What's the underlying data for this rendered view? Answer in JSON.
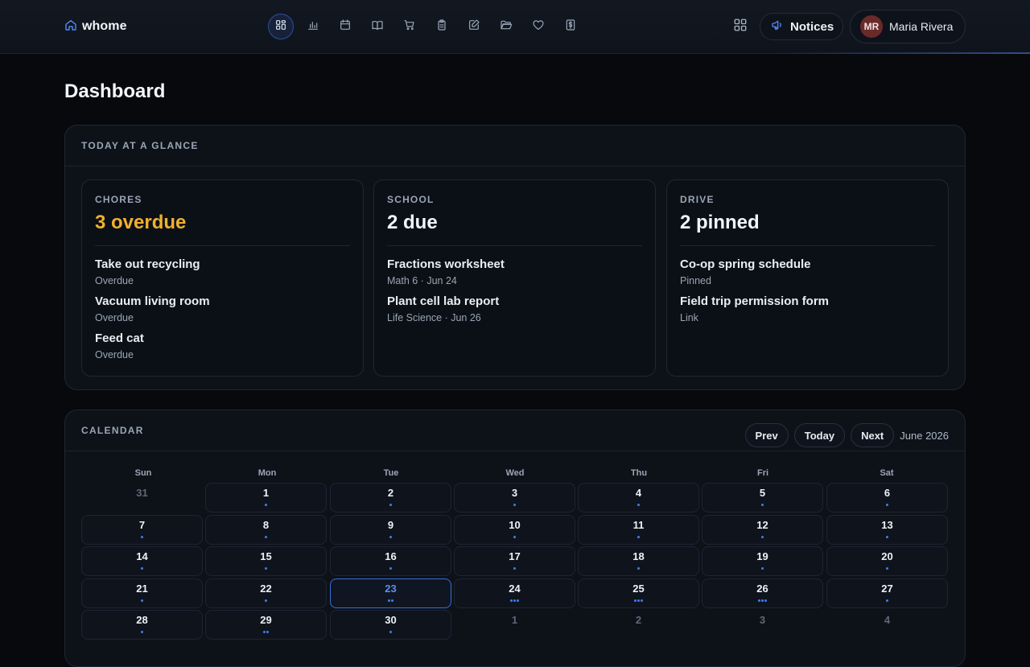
{
  "brand": {
    "name": "whome"
  },
  "header": {
    "nav": [
      {
        "icon": "dashboard-icon",
        "active": true
      },
      {
        "icon": "bar-chart-icon",
        "active": false
      },
      {
        "icon": "calendar-icon",
        "active": false
      },
      {
        "icon": "book-open-icon",
        "active": false
      },
      {
        "icon": "shopping-cart-icon",
        "active": false
      },
      {
        "icon": "clipboard-icon",
        "active": false
      },
      {
        "icon": "edit-note-icon",
        "active": false
      },
      {
        "icon": "folder-open-icon",
        "active": false
      },
      {
        "icon": "heart-icon",
        "active": false
      },
      {
        "icon": "dollar-receipt-icon",
        "active": false
      }
    ],
    "notices_label": "Notices",
    "user": {
      "initials": "MR",
      "name": "Maria Rivera"
    }
  },
  "page": {
    "title": "Dashboard"
  },
  "glance": {
    "title": "TODAY AT A GLANCE",
    "cards": [
      {
        "label": "CHORES",
        "value": "3 overdue",
        "warn": true,
        "items": [
          {
            "title": "Take out recycling",
            "sub": "Overdue"
          },
          {
            "title": "Vacuum living room",
            "sub": "Overdue"
          },
          {
            "title": "Feed cat",
            "sub": "Overdue"
          }
        ]
      },
      {
        "label": "SCHOOL",
        "value": "2 due",
        "warn": false,
        "items": [
          {
            "title": "Fractions worksheet",
            "sub": "Math 6 · Jun 24"
          },
          {
            "title": "Plant cell lab report",
            "sub": "Life Science · Jun 26"
          }
        ]
      },
      {
        "label": "DRIVE",
        "value": "2 pinned",
        "warn": false,
        "items": [
          {
            "title": "Co-op spring schedule",
            "sub": "Pinned"
          },
          {
            "title": "Field trip permission form",
            "sub": "Link"
          }
        ]
      }
    ]
  },
  "calendar": {
    "title": "CALENDAR",
    "prev_label": "Prev",
    "today_label": "Today",
    "next_label": "Next",
    "month_label": "June 2026",
    "weekdays": [
      "Sun",
      "Mon",
      "Tue",
      "Wed",
      "Thu",
      "Fri",
      "Sat"
    ],
    "weeks": [
      [
        {
          "d": "31",
          "muted": true,
          "dots": 0
        },
        {
          "d": "1",
          "dots": 1
        },
        {
          "d": "2",
          "dots": 1
        },
        {
          "d": "3",
          "dots": 1
        },
        {
          "d": "4",
          "dots": 1
        },
        {
          "d": "5",
          "dots": 1
        },
        {
          "d": "6",
          "dots": 1
        }
      ],
      [
        {
          "d": "7",
          "dots": 1
        },
        {
          "d": "8",
          "dots": 1
        },
        {
          "d": "9",
          "dots": 1
        },
        {
          "d": "10",
          "dots": 1
        },
        {
          "d": "11",
          "dots": 1
        },
        {
          "d": "12",
          "dots": 1
        },
        {
          "d": "13",
          "dots": 1
        }
      ],
      [
        {
          "d": "14",
          "dots": 1
        },
        {
          "d": "15",
          "dots": 1
        },
        {
          "d": "16",
          "dots": 1
        },
        {
          "d": "17",
          "dots": 1
        },
        {
          "d": "18",
          "dots": 1
        },
        {
          "d": "19",
          "dots": 1
        },
        {
          "d": "20",
          "dots": 1
        }
      ],
      [
        {
          "d": "21",
          "dots": 1
        },
        {
          "d": "22",
          "dots": 1
        },
        {
          "d": "23",
          "today": true,
          "dots": 2
        },
        {
          "d": "24",
          "dots": 3
        },
        {
          "d": "25",
          "dots": 3
        },
        {
          "d": "26",
          "dots": 3
        },
        {
          "d": "27",
          "dots": 1
        }
      ],
      [
        {
          "d": "28",
          "dots": 1
        },
        {
          "d": "29",
          "dots": 2
        },
        {
          "d": "30",
          "dots": 1
        },
        {
          "d": "1",
          "muted": true,
          "dots": 0
        },
        {
          "d": "2",
          "muted": true,
          "dots": 0
        },
        {
          "d": "3",
          "muted": true,
          "dots": 0
        },
        {
          "d": "4",
          "muted": true,
          "dots": 0
        }
      ]
    ]
  },
  "colors": {
    "accent": "#3d7ef5",
    "warn": "#f0b02e",
    "background": "#07090d"
  }
}
